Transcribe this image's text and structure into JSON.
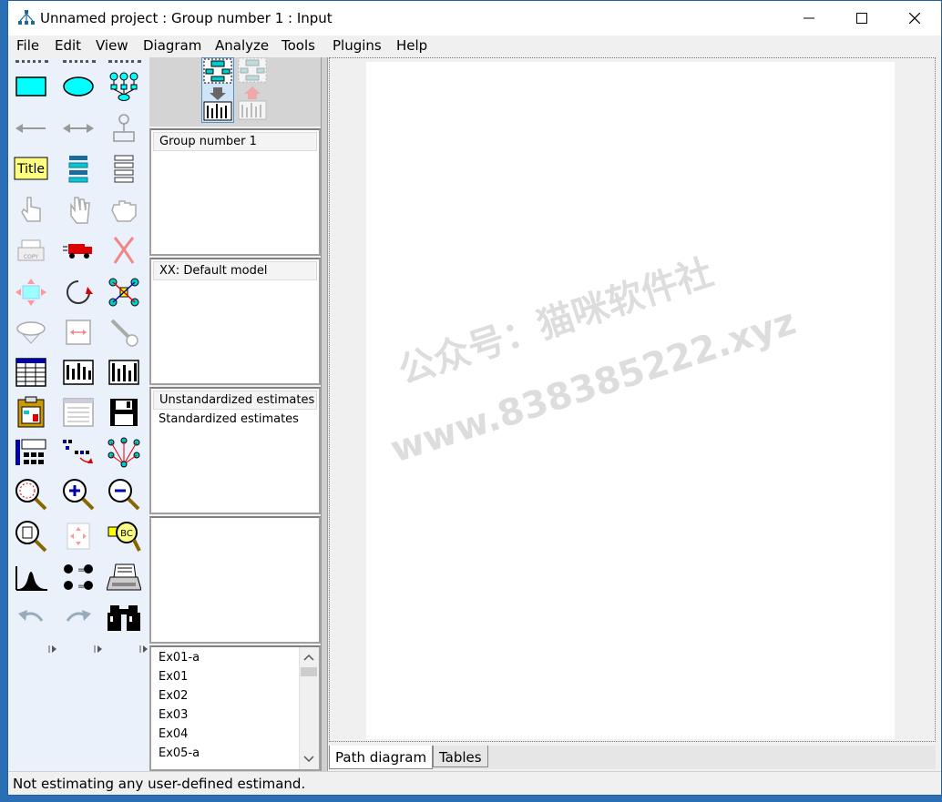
{
  "window": {
    "title": "Unnamed project : Group number 1 : Input"
  },
  "menu": {
    "file": "File",
    "edit": "Edit",
    "view": "View",
    "diagram": "Diagram",
    "analyze": "Analyze",
    "tools": "Tools",
    "plugins": "Plugins",
    "help": "Help"
  },
  "toolbox": {
    "title_tool_label": "Title"
  },
  "panels": {
    "groups": {
      "items": [
        "Group number 1"
      ]
    },
    "models": {
      "items": [
        "XX: Default model"
      ]
    },
    "estimates": {
      "items": [
        "Unstandardized estimates",
        "Standardized estimates"
      ]
    },
    "files": {
      "items": [
        "Ex01-a",
        "Ex01",
        "Ex02",
        "Ex03",
        "Ex04",
        "Ex05-a"
      ]
    }
  },
  "tabs": {
    "path_diagram": "Path diagram",
    "tables": "Tables"
  },
  "status": {
    "text": "Not estimating any user-defined estimand."
  },
  "watermark": {
    "line1": "公众号：猫咪软件社",
    "line2": "www.838385222.xyz"
  },
  "colors": {
    "accent": "#00ffff",
    "frame": "#1f5fa8",
    "toolbox_bg": "#eaf1fb"
  }
}
